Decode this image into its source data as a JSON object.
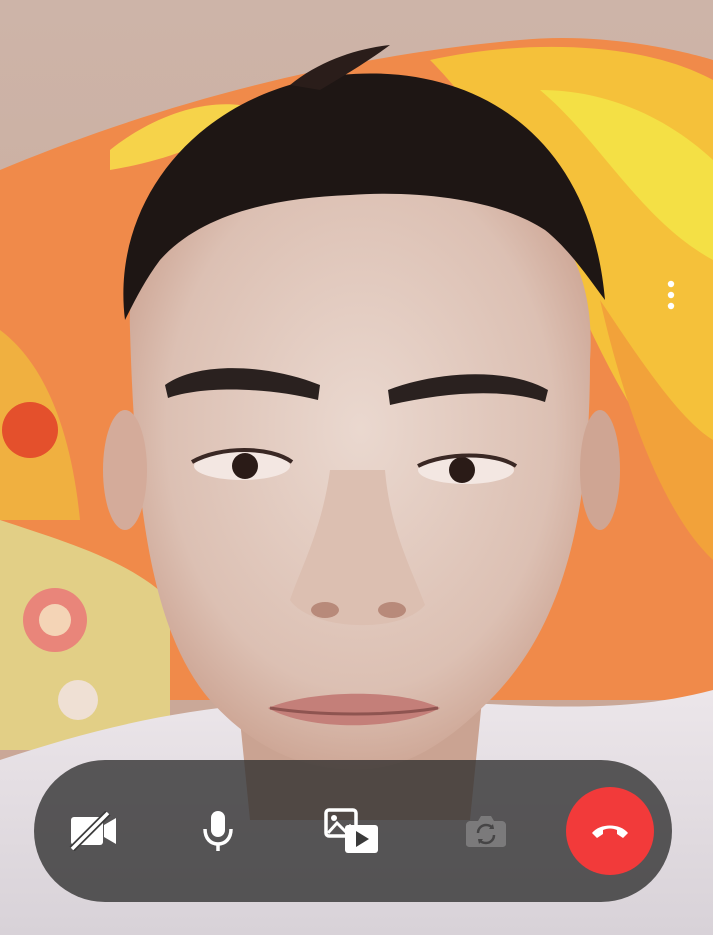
{
  "call": {
    "state": "video-call-active",
    "more_icon": "more-vertical-icon"
  },
  "controls": {
    "camera": {
      "icon": "video-off-icon",
      "active": false
    },
    "microphone": {
      "icon": "microphone-icon",
      "active": true
    },
    "share": {
      "icon": "media-share-icon"
    },
    "flip_camera": {
      "icon": "flip-camera-icon",
      "enabled": false
    },
    "end_call": {
      "icon": "end-call-icon",
      "color": "#f23a3a"
    }
  },
  "colors": {
    "control_bar": "#2e2e2e",
    "icon": "#ffffff",
    "end_call": "#f23a3a"
  }
}
